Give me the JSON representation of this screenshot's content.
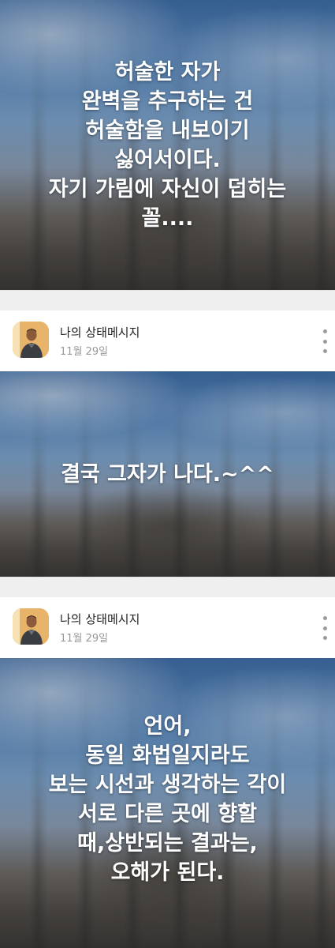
{
  "posts": [
    {
      "caption": "허술한 자가\n완벽을 추구하는 건\n허술함을 내보이기\n싫어서이다.\n자기 가림에 자신이 덥히는\n꼴...."
    },
    {
      "author": "나의 상태메시지",
      "date": "11월 29일",
      "caption": "결국 그자가 나다.~^^"
    },
    {
      "author": "나의 상태메시지",
      "date": "11월 29일",
      "caption": "언어,\n동일 화법일지라도\n보는 시선과 생각하는 각이\n서로 다른 곳에 향할\n때,상반되는 결과는,\n오해가 된다."
    }
  ],
  "icons": {
    "more": "more-vertical-icon",
    "avatar": "profile-avatar"
  },
  "colors": {
    "background": "#efefef",
    "header": "#ffffff",
    "author_text": "#222222",
    "date_text": "#999999",
    "caption_text": "#ffffff"
  }
}
